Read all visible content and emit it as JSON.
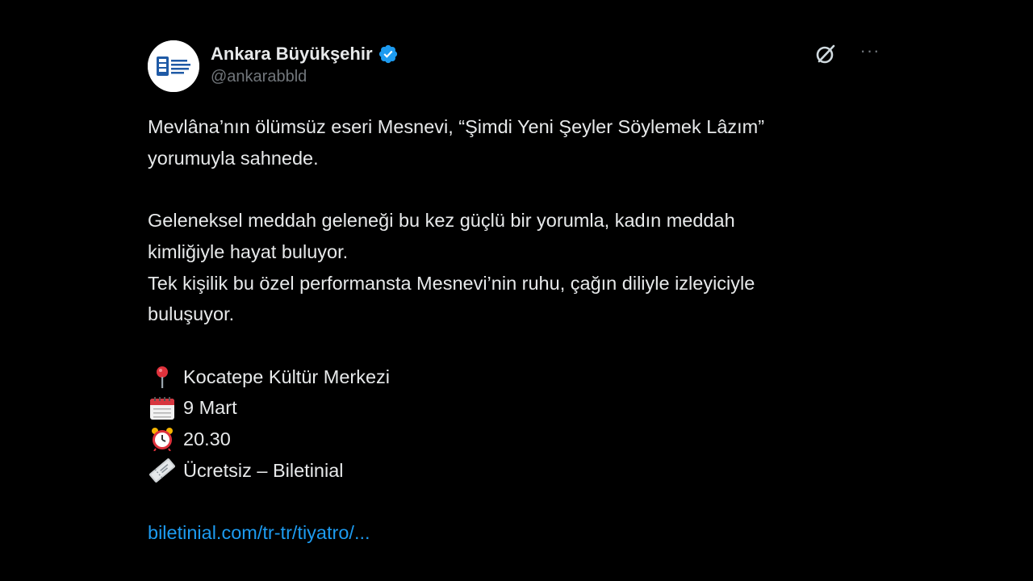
{
  "author": {
    "display_name": "Ankara Büyükşehir",
    "handle": "@ankarabbld",
    "verified": true,
    "avatar_icon": "ankara-municipality-logo"
  },
  "actions": {
    "grok_icon": "grok-icon",
    "more_icon": "more-icon",
    "more_glyph": "···"
  },
  "tweet": {
    "paragraph1_line1": "Mevlâna’nın ölümsüz eseri Mesnevi, “Şimdi Yeni Şeyler Söylemek Lâzım”",
    "paragraph1_line2": "yorumuyla sahnede.",
    "paragraph2_line1": "Geleneksel meddah geleneği bu kez güçlü bir yorumla, kadın meddah",
    "paragraph2_line2": "kimliğiyle hayat buluyor.",
    "paragraph2_line3": "Tek kişilik bu özel performansta Mesnevi’nin ruhu, çağın diliyle izleyiciyle",
    "paragraph2_line4": "buluşuyor.",
    "details": [
      {
        "icon": "pin-icon",
        "text": "Kocatepe Kültür Merkezi"
      },
      {
        "icon": "calendar-icon",
        "text": "9 Mart"
      },
      {
        "icon": "alarm-clock-icon",
        "text": "20.30"
      },
      {
        "icon": "ticket-icon",
        "text": "Ücretsiz – Biletinial"
      }
    ],
    "link": "biletinial.com/tr-tr/tiyatro/..."
  },
  "colors": {
    "background": "#000000",
    "text": "#e7e9ea",
    "secondary": "#71767b",
    "link": "#1d9bf0",
    "verified": "#1d9bf0"
  }
}
